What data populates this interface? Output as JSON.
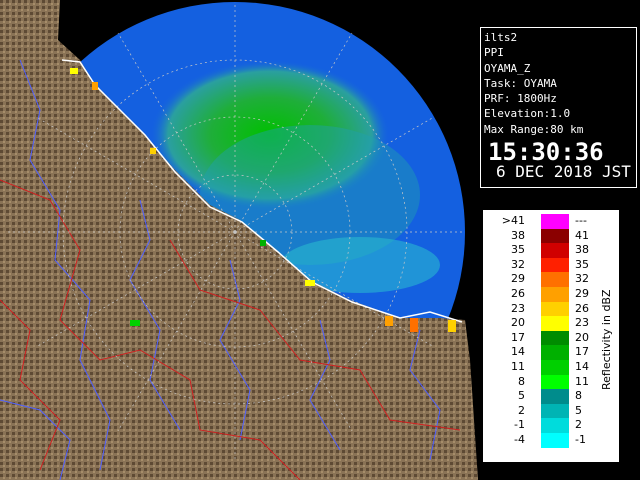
{
  "info": {
    "lines": [
      "ilts2",
      "PPI",
      "OYAMA_Z",
      "Task: OYAMA",
      "PRF: 1800Hz",
      "Elevation:1.0",
      "Max Range:80 km"
    ],
    "time": "15:30:36",
    "date": "6 DEC 2018 JST"
  },
  "legend": {
    "title": "Reflectivity in dBZ",
    "rows": [
      {
        "low": ">41",
        "high": "---",
        "color": "#ff00ff"
      },
      {
        "low": "38",
        "high": "41",
        "color": "#8b0000"
      },
      {
        "low": "35",
        "high": "38",
        "color": "#d00000"
      },
      {
        "low": "32",
        "high": "35",
        "color": "#ff2000"
      },
      {
        "low": "29",
        "high": "32",
        "color": "#ff7000"
      },
      {
        "low": "26",
        "high": "29",
        "color": "#ffa000"
      },
      {
        "low": "23",
        "high": "26",
        "color": "#ffd000"
      },
      {
        "low": "20",
        "high": "23",
        "color": "#ffff00"
      },
      {
        "low": "17",
        "high": "20",
        "color": "#008c00"
      },
      {
        "low": "14",
        "high": "17",
        "color": "#00b000"
      },
      {
        "low": "11",
        "high": "14",
        "color": "#00d000"
      },
      {
        "low": "8",
        "high": "11",
        "color": "#00ff00"
      },
      {
        "low": "5",
        "high": "8",
        "color": "#008c8c"
      },
      {
        "low": "2",
        "high": "5",
        "color": "#00b4b4"
      },
      {
        "low": "-1",
        "high": "2",
        "color": "#00dcdc"
      },
      {
        "low": "-4",
        "high": "-1",
        "color": "#00ffff"
      }
    ]
  },
  "colors": {
    "range_blue": "#1460e0",
    "terrain": "#8a7356",
    "terrain_dark": "#5e4a34",
    "sea_echo": "#22aa22",
    "coast": "#ffffff",
    "rivers": "#5060ff",
    "borders": "#d02020"
  }
}
